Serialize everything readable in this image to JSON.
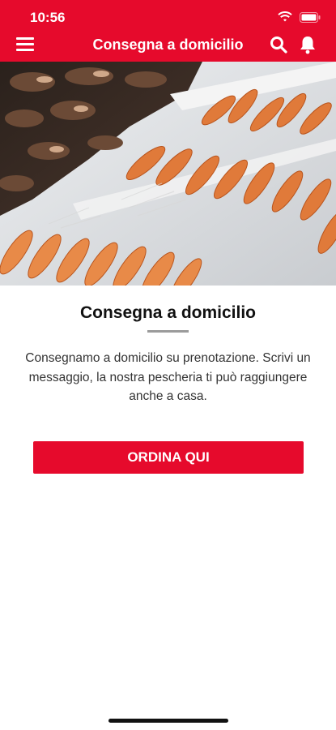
{
  "status_bar": {
    "time": "10:56"
  },
  "header": {
    "title": "Consegna a domicilio"
  },
  "hero": {
    "alt": "seafood display"
  },
  "main": {
    "title": "Consegna a domicilio",
    "description": "Consegnamo a domicilio su prenotazione. Scrivi un messaggio, la nostra pescheria ti può raggiungere anche a casa.",
    "order_button_label": "ORDINA QUI"
  },
  "icons": {
    "menu": "menu-icon",
    "search": "search-icon",
    "notifications": "bell-icon"
  },
  "colors": {
    "accent": "#e60a2c",
    "text": "#111111",
    "divider": "#9b9b9b"
  }
}
